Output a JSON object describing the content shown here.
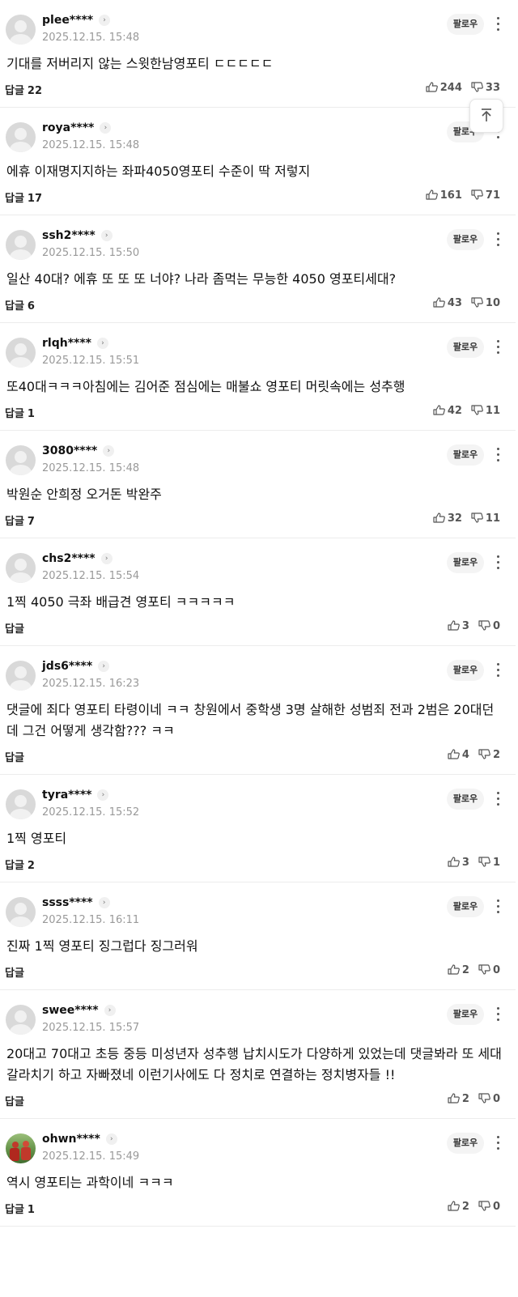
{
  "follow_label": "팔로우",
  "reply_label": "답글",
  "comments": [
    {
      "nick": "plee****",
      "date": "2025.12.15. 15:48",
      "text": "기대를 저버리지 않는 스윗한남영포티 ㄷㄷㄷㄷㄷ",
      "replies": "22",
      "up": "244",
      "down": "33",
      "avatar": "default"
    },
    {
      "nick": "roya****",
      "date": "2025.12.15. 15:48",
      "text": "에휴 이재명지지하는 좌파4050영포티 수준이 딱 저렇지",
      "replies": "17",
      "up": "161",
      "down": "71",
      "avatar": "default"
    },
    {
      "nick": "ssh2****",
      "date": "2025.12.15. 15:50",
      "text": "일산 40대? 에휴 또 또 또 너야? 나라 좀먹는 무능한 4050 영포티세대?",
      "replies": "6",
      "up": "43",
      "down": "10",
      "avatar": "default"
    },
    {
      "nick": "rlqh****",
      "date": "2025.12.15. 15:51",
      "text": "또40대ㅋㅋㅋ아침에는 김어준 점심에는 매불쇼 영포티 머릿속에는 성추행",
      "replies": "1",
      "up": "42",
      "down": "11",
      "avatar": "default"
    },
    {
      "nick": "3080****",
      "date": "2025.12.15. 15:48",
      "text": "박원순 안희정 오거돈 박완주",
      "replies": "7",
      "up": "32",
      "down": "11",
      "avatar": "default"
    },
    {
      "nick": "chs2****",
      "date": "2025.12.15. 15:54",
      "text": "1찍 4050 극좌 배급견 영포티 ㅋㅋㅋㅋㅋ",
      "replies": "",
      "up": "3",
      "down": "0",
      "avatar": "default"
    },
    {
      "nick": "jds6****",
      "date": "2025.12.15. 16:23",
      "text": "댓글에 죄다 영포티 타령이네 ㅋㅋ 창원에서 중학생 3명 살해한 성범죄 전과 2범은 20대던데 그건 어떻게 생각함??? ㅋㅋ",
      "replies": "",
      "up": "4",
      "down": "2",
      "avatar": "default"
    },
    {
      "nick": "tyra****",
      "date": "2025.12.15. 15:52",
      "text": "1찍 영포티",
      "replies": "2",
      "up": "3",
      "down": "1",
      "avatar": "default"
    },
    {
      "nick": "ssss****",
      "date": "2025.12.15. 16:11",
      "text": "진짜 1찍 영포티 징그럽다 징그러워",
      "replies": "",
      "up": "2",
      "down": "0",
      "avatar": "default"
    },
    {
      "nick": "swee****",
      "date": "2025.12.15. 15:57",
      "text": "20대고 70대고 초등 중등 미성년자 성추행 납치시도가 다양하게 있었는데 댓글봐라 또 세대 갈라치기 하고 자빠졌네 이런기사에도 다 정치로 연결하는 정치병자들 !!",
      "replies": "",
      "up": "2",
      "down": "0",
      "avatar": "default"
    },
    {
      "nick": "ohwn****",
      "date": "2025.12.15. 15:49",
      "text": "역시 영포티는 과학이네 ㅋㅋㅋ",
      "replies": "1",
      "up": "2",
      "down": "0",
      "avatar": "photo"
    }
  ]
}
